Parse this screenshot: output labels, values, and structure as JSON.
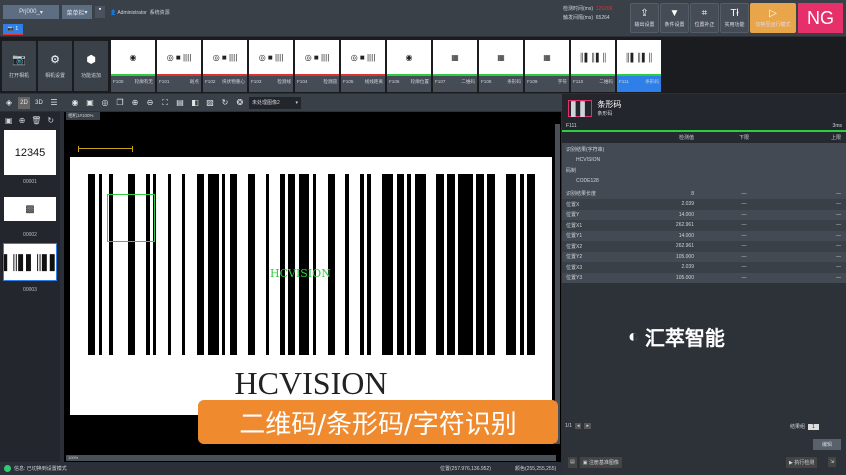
{
  "topbar": {
    "project": "Prj000_",
    "menu": "菜单栏",
    "user": "Administrator",
    "sys_resource": "系统资源",
    "detect_time_label": "检测时间(ms)",
    "detect_time": "126206",
    "trigger_label": "触发间隔(ms)",
    "trigger": "65264",
    "buttons": [
      {
        "label": "输出设置",
        "icon": "export-icon"
      },
      {
        "label": "条件设置",
        "icon": "filter-icon"
      },
      {
        "label": "位置补正",
        "icon": "position-correct-icon"
      },
      {
        "label": "实用功能",
        "icon": "tools-icon"
      }
    ],
    "run_mode": "切换至运行模式",
    "result": "NG",
    "camera_tab": "1"
  },
  "left_buttons": [
    {
      "label": "打开相机"
    },
    {
      "label": "相机设置"
    },
    {
      "label": "功能追加"
    }
  ],
  "flow": [
    {
      "id": "F100",
      "name": "轮廓有无"
    },
    {
      "id": "F101",
      "name": "斑点"
    },
    {
      "id": "F102",
      "name": "块状物重心"
    },
    {
      "id": "F103",
      "name": "检测线"
    },
    {
      "id": "F104",
      "name": "检测圆"
    },
    {
      "id": "F105",
      "name": "线线距离"
    },
    {
      "id": "F106",
      "name": "轮廓位置"
    },
    {
      "id": "F107",
      "name": "二维码"
    },
    {
      "id": "F108",
      "name": "条形码"
    },
    {
      "id": "F109",
      "name": "字符"
    },
    {
      "id": "F110",
      "name": "二维码"
    },
    {
      "id": "F111",
      "name": "条形码"
    }
  ],
  "toolbar": {
    "mode_2d": "2D",
    "mode_3d": "3D",
    "image_select": "未处理图像2",
    "canvas_tab": "相机1#100%",
    "zoom": "100%"
  },
  "thumbs": [
    {
      "text": "12345",
      "label": "00001"
    },
    {
      "label": "00002"
    },
    {
      "label": "00003"
    }
  ],
  "canvas": {
    "overlay_text": "HCVISION",
    "printed_text": "HCVISION"
  },
  "panel": {
    "title": "条形码",
    "subtitle": "条形码",
    "id": "F111",
    "time": "3ms",
    "headers": [
      "检测值",
      "下限",
      "上限"
    ],
    "result_label": "识别结果(字符串)",
    "result_value": "HCVISION",
    "code_label": "码制",
    "code_value": "CODE128",
    "rows": [
      {
        "name": "识别结果长度",
        "value": "8"
      },
      {
        "name": "位置X",
        "value": "2.039"
      },
      {
        "name": "位置Y",
        "value": "14.000"
      },
      {
        "name": "位置X1",
        "value": "262.961"
      },
      {
        "name": "位置Y1",
        "value": "14.000"
      },
      {
        "name": "位置X2",
        "value": "262.961"
      },
      {
        "name": "位置Y2",
        "value": "105.000"
      },
      {
        "name": "位置X3",
        "value": "2.039"
      },
      {
        "name": "位置Y3",
        "value": "105.000"
      }
    ],
    "dash": "—",
    "page": "1/1",
    "group_label": "结果组",
    "group_value": "1",
    "edit": "编辑",
    "register": "注册基准图像",
    "execute": "执行检测"
  },
  "status": {
    "info": "信息: 已切换到设置模式",
    "position": "位置(257.976,136.952)",
    "color": "颜色(255,255,255)"
  },
  "logo": "汇萃智能",
  "banner": "二维码/条形码/字符识别"
}
